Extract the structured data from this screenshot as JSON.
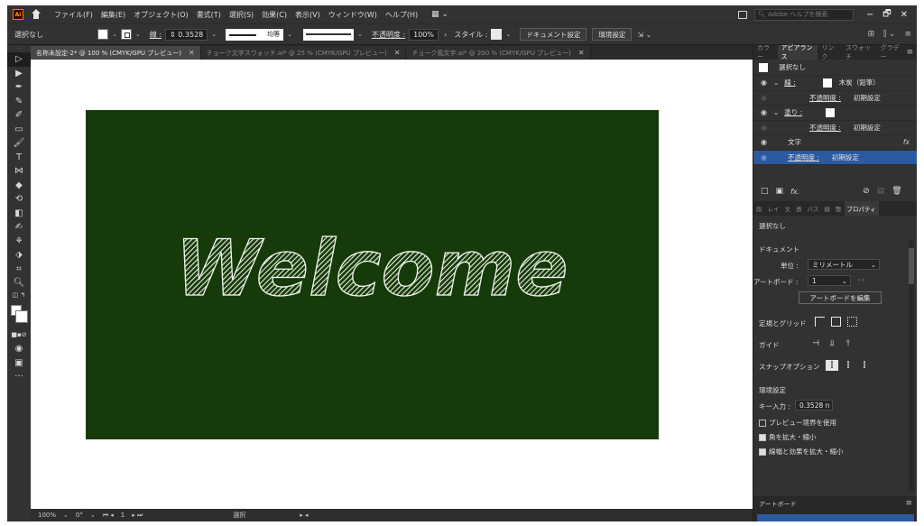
{
  "menubar": {
    "logo": "Ai",
    "items": [
      "ファイル(F)",
      "編集(E)",
      "オブジェクト(O)",
      "書式(T)",
      "選択(S)",
      "効果(C)",
      "表示(V)",
      "ウィンドウ(W)",
      "ヘルプ(H)"
    ],
    "search_placeholder": "Adobe ヘルプを検索",
    "window_controls": [
      "−",
      "🗗",
      "✕"
    ]
  },
  "controlbar": {
    "selection": "選択なし",
    "stroke_label": "線 :",
    "stroke_width": "0.3528",
    "profile_label": "均等",
    "opacity_label": "不透明度 :",
    "opacity_value": "100%",
    "style_label": "スタイル :",
    "doc_setup": "ドキュメント設定",
    "prefs": "環境設定"
  },
  "tabs": [
    {
      "label": "名称未設定-2* @ 100 % (CMYK/GPU プレビュー)",
      "active": true
    },
    {
      "label": "チョーク文字スウォッチ.ai* @ 25 % (CMYK/GPU プレビュー)",
      "active": false
    },
    {
      "label": "チョーク風文字.ai* @ 200 % (CMYK/GPU プレビュー)",
      "active": false
    }
  ],
  "artboard": {
    "text": "Welcome",
    "background_color": "#173a0a"
  },
  "statusbar": {
    "zoom": "100%",
    "rotation": "0°",
    "artboard_num": "1",
    "mode": "選択"
  },
  "appearance_panel": {
    "tabs": [
      "カラー",
      "アピアランス",
      "リンク",
      "スウォッチ",
      "グラデー"
    ],
    "active_tab": "アピアランス",
    "header": "選択なし",
    "rows": [
      {
        "type": "stroke",
        "label": "線 :",
        "value": "木炭（鉛筆）"
      },
      {
        "type": "opacity",
        "label": "不透明度 :",
        "value": "初期設定"
      },
      {
        "type": "fill",
        "label": "塗り :",
        "value": ""
      },
      {
        "type": "opacity",
        "label": "不透明度 :",
        "value": "初期設定"
      },
      {
        "type": "chars",
        "label": "文字",
        "value": ""
      },
      {
        "type": "opacity",
        "label": "不透明度 :",
        "value": "初期設定"
      }
    ]
  },
  "properties_panel": {
    "tabs": [
      "段",
      "レイ",
      "文",
      "透",
      "パス",
      "線",
      "整",
      "プロパティ"
    ],
    "active_tab": "プロパティ",
    "selection": "選択なし",
    "document_label": "ドキュメント",
    "units_label": "単位 :",
    "units_value": "ミリメートル",
    "artboard_label": "アートボード :",
    "artboard_value": "1",
    "edit_artboard": "アートボードを編集",
    "rulers_grid": "定規とグリッド",
    "guides": "ガイド",
    "snap_options": "スナップオプション",
    "preferences": "環境設定",
    "key_increment_label": "キー入力 :",
    "key_increment_value": "0.3528 n",
    "checkbox_preview": "プレビュー境界を使用",
    "checkbox_corners": "角を拡大・縮小",
    "checkbox_strokes": "線幅と効果を拡大・縮小"
  },
  "artboards_panel": {
    "label": "アートボード"
  }
}
